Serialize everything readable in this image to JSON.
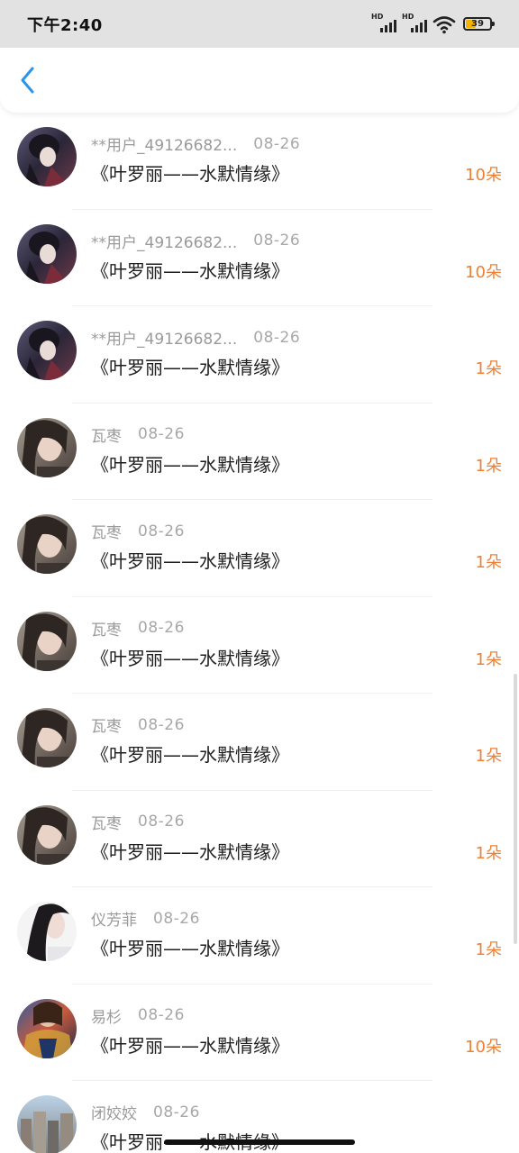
{
  "status_bar": {
    "time": "下午2:40",
    "signal1_label": "HD",
    "signal2_label": "HD",
    "battery_level": "39"
  },
  "nav": {
    "back_icon": "chevron-left-icon",
    "accent_color": "#2b95e9"
  },
  "colors": {
    "count": "#ee8036",
    "meta": "#9a9a9a",
    "title": "#1e1e1e"
  },
  "items": [
    {
      "user": "**用户_49126682...",
      "date": "08-26",
      "title": "《叶罗丽——水默情缘》",
      "count": "10朵",
      "avatar": "dark-anime"
    },
    {
      "user": "**用户_49126682...",
      "date": "08-26",
      "title": "《叶罗丽——水默情缘》",
      "count": "10朵",
      "avatar": "dark-anime"
    },
    {
      "user": "**用户_49126682...",
      "date": "08-26",
      "title": "《叶罗丽——水默情缘》",
      "count": "1朵",
      "avatar": "dark-anime"
    },
    {
      "user": "瓦枣",
      "date": "08-26",
      "title": "《叶罗丽——水默情缘》",
      "count": "1朵",
      "avatar": "girl-portrait"
    },
    {
      "user": "瓦枣",
      "date": "08-26",
      "title": "《叶罗丽——水默情缘》",
      "count": "1朵",
      "avatar": "girl-portrait"
    },
    {
      "user": "瓦枣",
      "date": "08-26",
      "title": "《叶罗丽——水默情缘》",
      "count": "1朵",
      "avatar": "girl-portrait"
    },
    {
      "user": "瓦枣",
      "date": "08-26",
      "title": "《叶罗丽——水默情缘》",
      "count": "1朵",
      "avatar": "girl-portrait"
    },
    {
      "user": "瓦枣",
      "date": "08-26",
      "title": "《叶罗丽——水默情缘》",
      "count": "1朵",
      "avatar": "girl-portrait"
    },
    {
      "user": "仪芳菲",
      "date": "08-26",
      "title": "《叶罗丽——水默情缘》",
      "count": "1朵",
      "avatar": "white-girl"
    },
    {
      "user": "易杉",
      "date": "08-26",
      "title": "《叶罗丽——水默情缘》",
      "count": "10朵",
      "avatar": "colorful-jacket"
    },
    {
      "user": "闭姣姣",
      "date": "08-26",
      "title": "《叶罗丽——水默情缘》",
      "count": "",
      "avatar": "city-scene"
    }
  ]
}
